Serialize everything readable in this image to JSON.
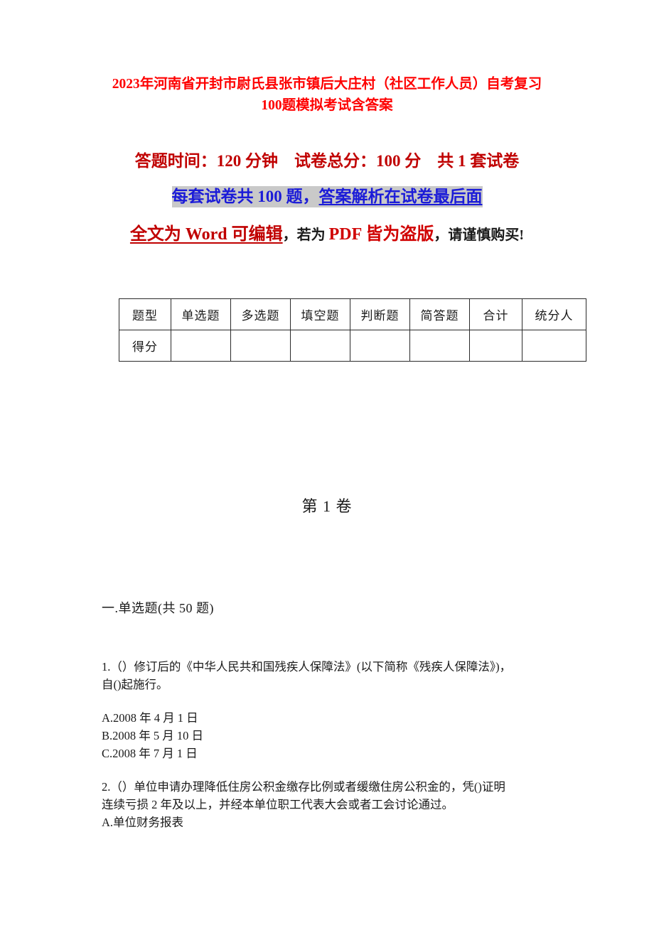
{
  "document": {
    "title": "2023年河南省开封市尉氏县张市镇后大庄村（社区工作人员）自考复习100题模拟考试含答案",
    "colors": {
      "title_red": "#FE0000",
      "info_dark_red": "#C00000",
      "highlight_blue": "#1B1BD8",
      "highlight_gray": "#C9C9C9",
      "body_text": "#1A1A1A"
    }
  },
  "info": {
    "line1": "答题时间：120 分钟    试卷总分：100 分    共 1 套试卷",
    "line2_plain": "每套试卷共 100 题，",
    "line2_underlined": "答案解析在试卷最后面",
    "line3_red_underlined": "全文为 Word 可编辑",
    "line3_dark_1": "，若为 ",
    "line3_red_bold": "PDF 皆为盗版",
    "line3_dark_2": "，请谨慎购买!"
  },
  "score_table": {
    "headers": [
      "题型",
      "单选题",
      "多选题",
      "填空题",
      "判断题",
      "简答题",
      "合计",
      "统分人"
    ],
    "rows": [
      {
        "label": "得分",
        "cells": [
          "",
          "",
          "",
          "",
          "",
          "",
          ""
        ]
      }
    ]
  },
  "volume_heading": "第 1 卷",
  "section": {
    "heading": "一.单选题(共 50 题)"
  },
  "questions": [
    {
      "number": "1",
      "text": "1.（）修订后的《中华人民共和国残疾人保障法》(以下简称《残疾人保障法》)，",
      "text_line2": "自()起施行。",
      "options": [
        "A.2008 年 4 月 1 日",
        "B.2008 年 5 月 10 日",
        "C.2008 年 7 月 1 日"
      ]
    },
    {
      "number": "2",
      "text": "2.（）单位申请办理降低住房公积金缴存比例或者缓缴住房公积金的，凭()证明",
      "text_line2": "连续亏损 2 年及以上，并经本单位职工代表大会或者工会讨论通过。",
      "options": [
        "A.单位财务报表"
      ]
    }
  ]
}
